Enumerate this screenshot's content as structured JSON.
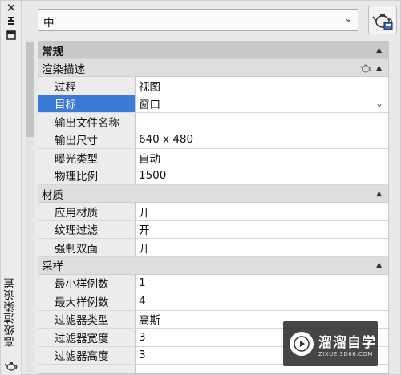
{
  "strip": {
    "close_glyph": "✕",
    "title": "高级渲染设置"
  },
  "top": {
    "preset_value": "中"
  },
  "sections": {
    "general": "常规",
    "render_desc": "渲染描述",
    "materials": "材质",
    "sampling": "采样"
  },
  "render_desc_rows": [
    {
      "name": "过程",
      "value": "视图"
    },
    {
      "name": "目标",
      "value": "窗口"
    },
    {
      "name": "输出文件名称",
      "value": ""
    },
    {
      "name": "输出尺寸",
      "value": "640 x 480"
    },
    {
      "name": "曝光类型",
      "value": "自动"
    },
    {
      "name": "物理比例",
      "value": "1500"
    }
  ],
  "materials_rows": [
    {
      "name": "应用材质",
      "value": "开"
    },
    {
      "name": "纹理过滤",
      "value": "开"
    },
    {
      "name": "强制双面",
      "value": "开"
    }
  ],
  "sampling_rows": [
    {
      "name": "最小样例数",
      "value": "1"
    },
    {
      "name": "最大样例数",
      "value": "4"
    },
    {
      "name": "过滤器类型",
      "value": "高斯"
    },
    {
      "name": "过滤器宽度",
      "value": "3"
    },
    {
      "name": "过滤器高度",
      "value": "3"
    }
  ],
  "watermark": {
    "brand": "溜溜自学",
    "url": "ZIXUE.3D66.COM"
  },
  "colors": {
    "selected_row": "#3a7bd5",
    "header_bg": "#c9c9c9",
    "category_bg": "#dedede"
  }
}
